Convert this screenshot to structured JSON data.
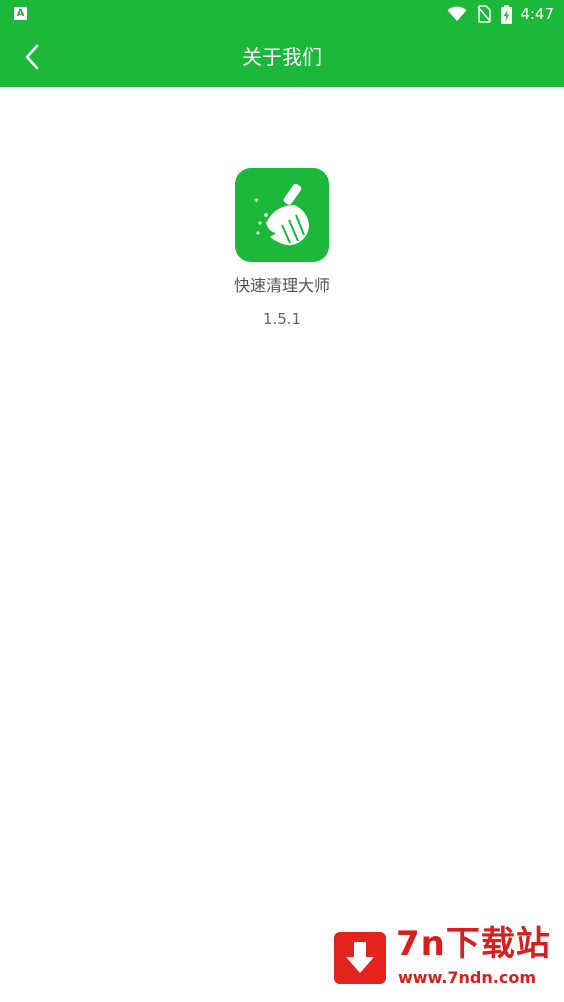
{
  "colors": {
    "brand_green": "#1cb83a",
    "background": "#ffffff",
    "title_text": "#ffffff",
    "body_text": "#555555",
    "watermark_red": "#d81e1e"
  },
  "status_bar": {
    "time": "4:47",
    "icons": [
      "app-notification-icon",
      "wifi-icon",
      "no-sim-icon",
      "battery-charging-icon"
    ]
  },
  "nav_bar": {
    "title": "关于我们",
    "back_icon": "chevron-left-icon"
  },
  "about": {
    "app_icon": "broom-icon",
    "app_name": "快速清理大师",
    "version": "1.5.1"
  },
  "watermark": {
    "title": "7n下载站",
    "url": "www.7ndn.com",
    "icon": "download-arrow-icon"
  }
}
